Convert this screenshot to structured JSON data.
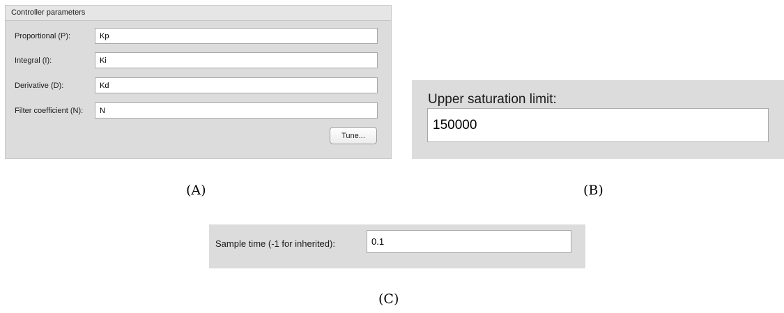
{
  "panel_a": {
    "header": "Controller parameters",
    "params": [
      {
        "label": "Proportional (P):",
        "value": "Kp"
      },
      {
        "label": "Integral (I):",
        "value": "Ki"
      },
      {
        "label": "Derivative (D):",
        "value": "Kd"
      },
      {
        "label": "Filter coefficient (N):",
        "value": "N"
      }
    ],
    "tune_label": "Tune...",
    "caption": "(A)"
  },
  "panel_b": {
    "label": "Upper saturation limit:",
    "value": "150000",
    "caption": "(B)"
  },
  "panel_c": {
    "label": "Sample time (-1 for inherited):",
    "value": "0.1",
    "caption": "(C)"
  }
}
